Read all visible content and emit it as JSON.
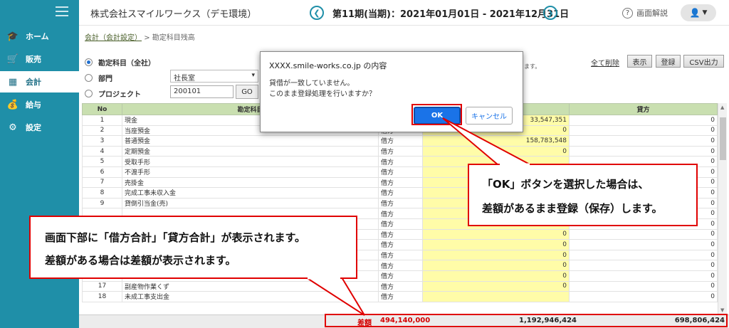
{
  "sidebar": {
    "items": [
      {
        "label": "ホーム",
        "icon": "graduation-cap-icon"
      },
      {
        "label": "販売",
        "icon": "cart-icon"
      },
      {
        "label": "会計",
        "icon": "calculator-icon"
      },
      {
        "label": "給与",
        "icon": "money-bag-icon"
      },
      {
        "label": "設定",
        "icon": "gear-icon"
      }
    ],
    "active": "会計"
  },
  "header": {
    "company": "株式会社スマイルワークス（デモ環境）",
    "period": "第11期(当期)：2021年01月01日 - 2021年12月31日",
    "help_label": "画面解説"
  },
  "breadcrumb": {
    "parent": "会計（会計設定）",
    "separator": ">",
    "current": "勘定科目残高"
  },
  "filters": {
    "account_label": "勘定科目（全社）",
    "dept_label": "部門",
    "dept_value": "社長室",
    "project_label": "プロジェクト",
    "project_value": "200101",
    "go_label": "GO"
  },
  "toolbar": {
    "clear_all": "全て削除",
    "show": "表示",
    "register": "登録",
    "csv": "CSV出力",
    "trailing_text": "ます。"
  },
  "table": {
    "headers": {
      "no": "No",
      "account": "勘定科目",
      "debit": "借方",
      "credit": "貸方"
    },
    "rows": [
      {
        "no": "1",
        "name": "現金",
        "side": "",
        "debit": "33,547,351",
        "credit": "0"
      },
      {
        "no": "2",
        "name": "当座預金",
        "side": "借方",
        "debit": "0",
        "credit": "0"
      },
      {
        "no": "3",
        "name": "普通預金",
        "side": "借方",
        "debit": "158,783,548",
        "credit": "0"
      },
      {
        "no": "4",
        "name": "定期預金",
        "side": "借方",
        "debit": "0",
        "credit": "0"
      },
      {
        "no": "5",
        "name": "受取手形",
        "side": "借方",
        "debit": "",
        "credit": "0"
      },
      {
        "no": "6",
        "name": "不渡手形",
        "side": "借方",
        "debit": "",
        "credit": "0"
      },
      {
        "no": "7",
        "name": "売掛金",
        "side": "借方",
        "debit": "",
        "credit": "0"
      },
      {
        "no": "8",
        "name": "完成工事未収入金",
        "side": "借方",
        "debit": "",
        "credit": "0"
      },
      {
        "no": "9",
        "name": "貸倒引当金(売)",
        "side": "借方",
        "debit": "",
        "credit": "0"
      },
      {
        "no": "",
        "name": "",
        "side": "借方",
        "debit": "",
        "credit": "0"
      },
      {
        "no": "",
        "name": "",
        "side": "借方",
        "debit": "0",
        "credit": "0"
      },
      {
        "no": "",
        "name": "",
        "side": "借方",
        "debit": "0",
        "credit": "0"
      },
      {
        "no": "",
        "name": "",
        "side": "借方",
        "debit": "0",
        "credit": "0"
      },
      {
        "no": "",
        "name": "",
        "side": "借方",
        "debit": "0",
        "credit": "0"
      },
      {
        "no": "15",
        "name": "原材料",
        "side": "借方",
        "debit": "0",
        "credit": "0"
      },
      {
        "no": "16",
        "name": "貯蔵品",
        "side": "借方",
        "debit": "0",
        "credit": "0"
      },
      {
        "no": "17",
        "name": "副産物作業くず",
        "side": "借方",
        "debit": "0",
        "credit": "0"
      },
      {
        "no": "18",
        "name": "未成工事支出金",
        "side": "借方",
        "debit": "",
        "credit": "0"
      }
    ]
  },
  "footer": {
    "diff_label": "差額",
    "diff_value": "494,140,000",
    "debit_total": "1,192,946,424",
    "credit_total": "698,806,424"
  },
  "dialog": {
    "title": "XXXX.smile-works.co.jp の内容",
    "line1": "貸借が一致していません。",
    "line2": "このまま登録処理を行いますか？",
    "ok": "OK",
    "cancel": "キャンセル"
  },
  "callouts": {
    "bottom_l1": "画面下部に「借方合計」「貸方合計」が表示されます。",
    "bottom_l2": "差額がある場合は差額が表示されます。",
    "ok_l1": "「OK」ボタンを選択した場合は、",
    "ok_l2": "差額があるまま登録（保存）します。"
  },
  "colors": {
    "sidebar": "#1f8fa8",
    "highlight": "#e00000",
    "debit_column": "#fffca8",
    "header_row": "#c9dfb0"
  }
}
